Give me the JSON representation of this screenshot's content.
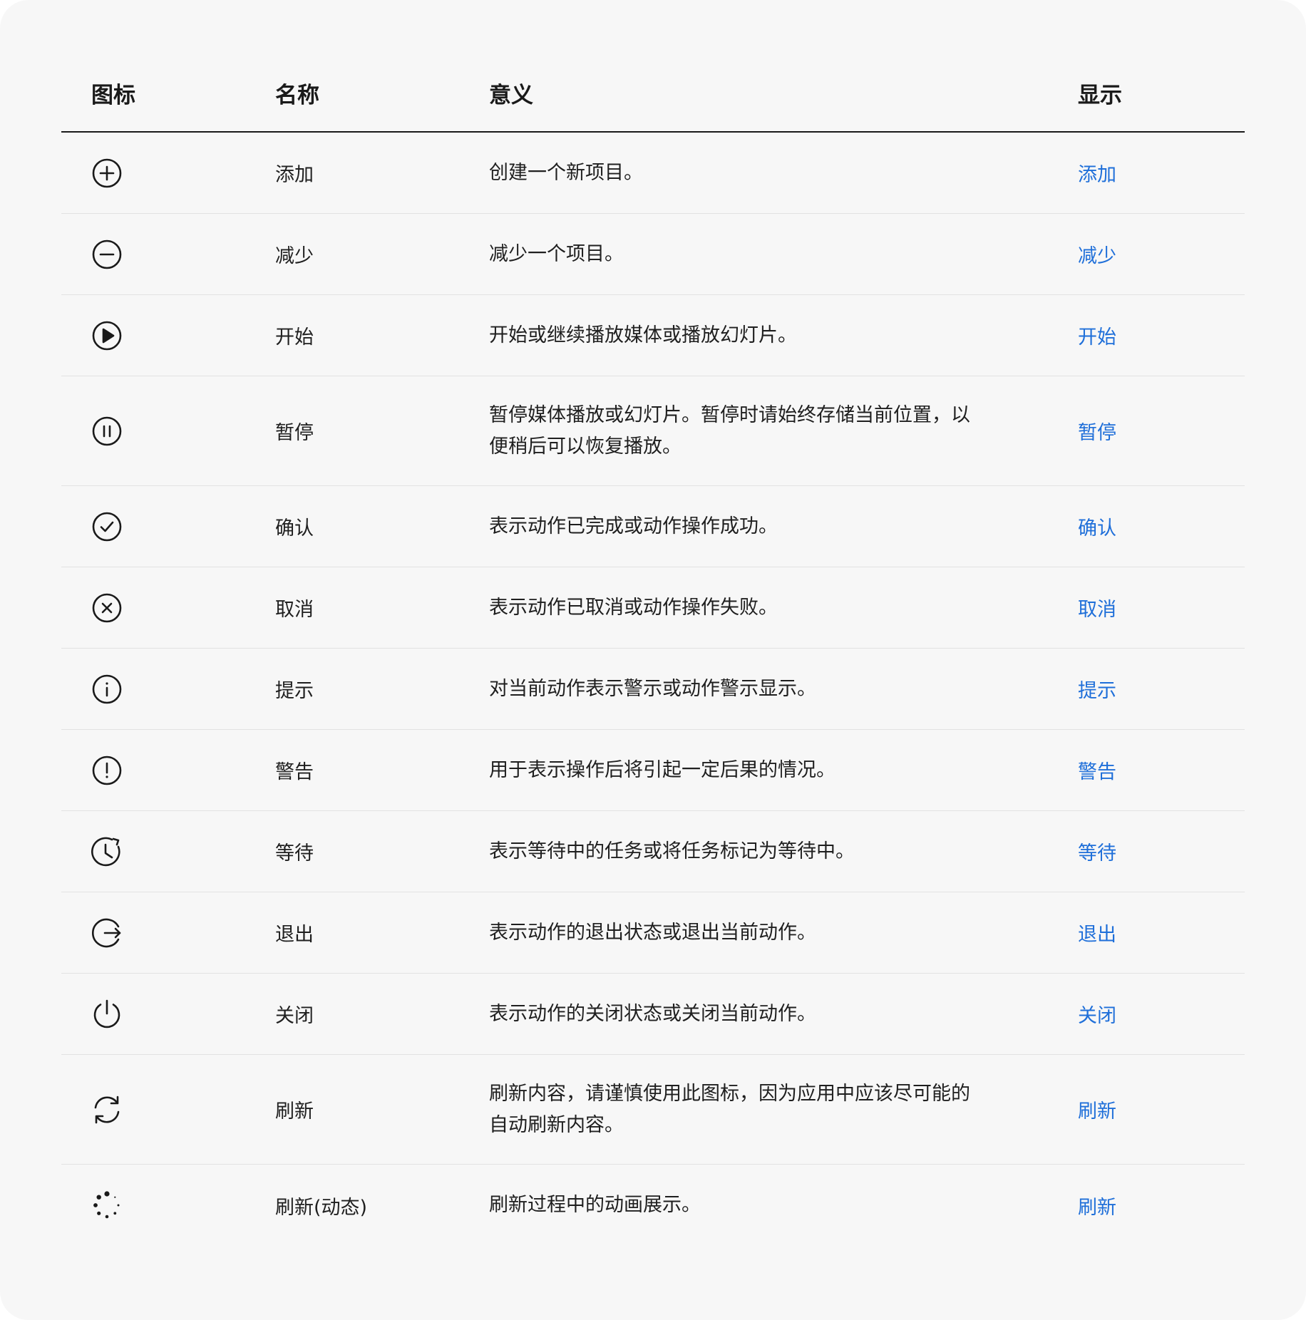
{
  "header": {
    "icon": "图标",
    "name": "名称",
    "meaning": "意义",
    "display": "显示"
  },
  "rows": [
    {
      "icon": "plus-circle-icon",
      "name": "添加",
      "meaning": "创建一个新项目。",
      "display": "添加"
    },
    {
      "icon": "minus-circle-icon",
      "name": "减少",
      "meaning": "减少一个项目。",
      "display": "减少"
    },
    {
      "icon": "play-circle-icon",
      "name": "开始",
      "meaning": "开始或继续播放媒体或播放幻灯片。",
      "display": "开始"
    },
    {
      "icon": "pause-circle-icon",
      "name": "暂停",
      "meaning": "暂停媒体播放或幻灯片。暂停时请始终存储当前位置，以便稍后可以恢复播放。",
      "display": "暂停"
    },
    {
      "icon": "check-circle-icon",
      "name": "确认",
      "meaning": "表示动作已完成或动作操作成功。",
      "display": "确认"
    },
    {
      "icon": "close-circle-icon",
      "name": "取消",
      "meaning": "表示动作已取消或动作操作失败。",
      "display": "取消"
    },
    {
      "icon": "info-circle-icon",
      "name": "提示",
      "meaning": "对当前动作表示警示或动作警示显示。",
      "display": "提示"
    },
    {
      "icon": "warning-circle-icon",
      "name": "警告",
      "meaning": "用于表示操作后将引起一定后果的情况。",
      "display": "警告"
    },
    {
      "icon": "clock-wait-icon",
      "name": "等待",
      "meaning": "表示等待中的任务或将任务标记为等待中。",
      "display": "等待"
    },
    {
      "icon": "exit-icon",
      "name": "退出",
      "meaning": "表示动作的退出状态或退出当前动作。",
      "display": "退出"
    },
    {
      "icon": "power-icon",
      "name": "关闭",
      "meaning": "表示动作的关闭状态或关闭当前动作。",
      "display": "关闭"
    },
    {
      "icon": "refresh-icon",
      "name": "刷新",
      "meaning": "刷新内容，请谨慎使用此图标，因为应用中应该尽可能的自动刷新内容。",
      "display": "刷新"
    },
    {
      "icon": "spinner-icon",
      "name": "刷新(动态)",
      "meaning": "刷新过程中的动画展示。",
      "display": "刷新"
    }
  ]
}
